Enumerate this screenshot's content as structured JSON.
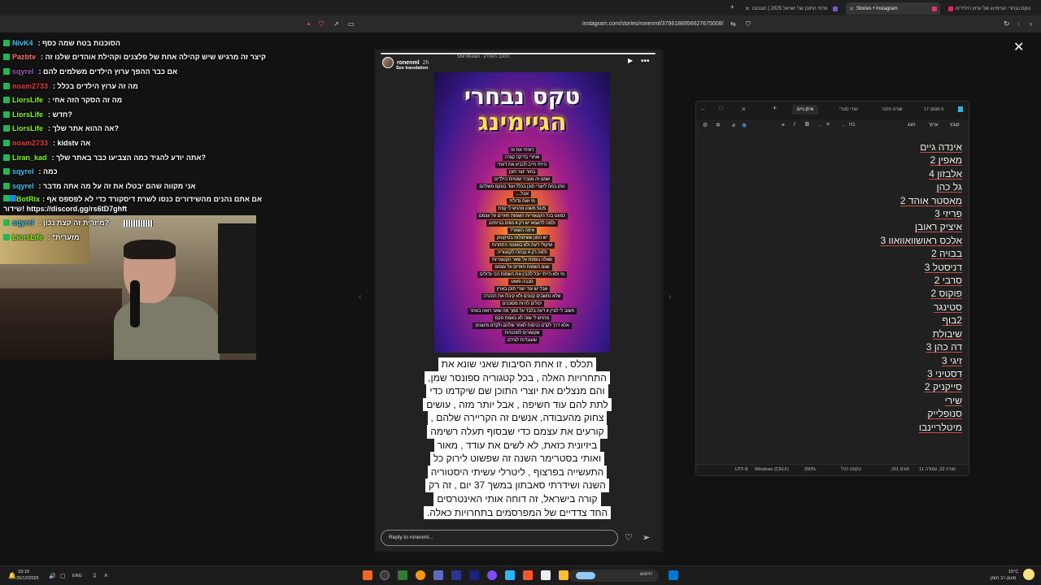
{
  "browser": {
    "tabs": [
      {
        "label": "טקס נבחרי הגיימינג של ערוץ הילידים",
        "color": "#e91e63"
      },
      {
        "label": "Stories • Instagram",
        "color": "#e1306c",
        "active": true
      },
      {
        "label": "פרסי התוכן של ישראל 2025 | הצבעה",
        "color": "#7e57c2"
      }
    ],
    "url": "instagram.com/stories/ronenml/3796188956627675008/"
  },
  "chat": [
    {
      "user": "NivK4",
      "color": "#33c3f0",
      "msg": ": הסוכנות בטח שמה כסף"
    },
    {
      "user": "Pazbtv",
      "color": "#ff6f61",
      "msg": ": קיצר זה מרגיש שיש קהילה אחת של פלצנים וקהילת אוהדים שלנו זה"
    },
    {
      "user": "sqyrel",
      "color": "#9b59b6",
      "msg": ": אם כבר ההפך ערוץ הילדים משלמים להם"
    },
    {
      "user": "noam2733",
      "color": "#e53935",
      "msg": ": מה זה ערוץ הילדים בכלל"
    },
    {
      "user": "LiorsLife",
      "color": "#7cfc00",
      "msg": ": מה זה הסקר הזה אחי"
    },
    {
      "user": "LiorsLife",
      "color": "#7cfc00",
      "msg": ": חדש?"
    },
    {
      "user": "LiorsLife",
      "color": "#7cfc00",
      "msg": ": אה ההוא אתר שלך?"
    },
    {
      "user": "noam2733",
      "color": "#e53935",
      "msg": ": kidstv אה"
    },
    {
      "user": "Liran_kad",
      "color": "#7cfc00",
      "msg": ": אתה יודע להגיד כמה הצביעו כבר באתר שלך?"
    },
    {
      "user": "sqyrel",
      "color": "#33c3f0",
      "msg": ": כמה"
    },
    {
      "user": "sqyrel",
      "color": "#33c3f0",
      "msg": ": אני מקווה שהם יבטלו את זה על מה אתה מדבר"
    },
    {
      "user": "BotRix",
      "color": "#7cfc00",
      "msg": ": אם אתם נהנים מהשידורים כנסו לשרת דיסקורד כדי לא לפספס אף שידור! https://discord.gg/rs6tD7ghft",
      "tall": true,
      "bot": true
    },
    {
      "user": "sqyrel",
      "color": "#33c3f0",
      "msg": ": מיזרית זה קצת נכון?"
    },
    {
      "user": "LiorsLife",
      "color": "#7cfc00",
      "msg": ": *מזערית"
    }
  ],
  "story": {
    "username": "ronenml",
    "time": "2h",
    "see_translation": "See translation",
    "music": "Shir Musari · הכוכב האחרון",
    "poster_title_1": "טקס נבחרי",
    "poster_title_2": "הגיימינג",
    "poster_lines": [
      "ראיתי את זה",
      "ואחרי בדיקה קצרה",
      "הייתי חייב להביע את דעתי",
      "בתור יוצר תוכן",
      "שמנו זה מגביר שטויות הילדים",
      "נותן במה ליוצרי תוכן בכלל ועוד בטקס משלהם",
      "אבל....",
      "מי זאת גדול!!!",
      "SUS משהו מרגיש לי קצת",
      "כמעט בכל הקטגוריות השמות חוזרים על עצמם",
      "ולמה לדוגמא יש רק 4 נשים בגיימינג",
      "איפה השאר?",
      "יש המון ששיפולות בטיקטוק",
      "שיקולי דעת ולא באוונטי התחרות",
      "ולמה רק 4 נבחרו לקטגוריה",
      "שאלה נוספת על שאר הקטגוריות",
      "שגם השמות חוזרים על עצמם",
      "מי ולא הייתי יוכל להבין את השמות הכי גדולים",
      "סבבה פשוט",
      "אבל יש עוד יוצרי תוכן בארץ",
      "שלא נחשבים קטנים ולא קיבלו את ההכרה",
      "יכולים להיות מסוכנים",
      "חשוב לי לציין זו דעה בלבד על סמך מה שאני רואה באתר",
      "מרגיש לי שזה לא באמת טקס",
      "אלא דרך לקדם כניסות לאתר שלהם ולקדם מיוצגים",
      "שקשורים לסוכנויות",
      "שעובדות לצידם"
    ],
    "text_lines": [
      "תכלס , זו אחת הסיבות שאני שונא את",
      "התחרויות האלה , בכל קטגוריה ספונסר שמן,",
      "והם מנצלים את יוצרי התוכן שם שיקדמו כדי",
      "לתת להם עוד חשיפה , אבל יותר מזה , עושים",
      "צחוק מהעבודה, אנשים זה הקריירה שלהם ,",
      "קורעים את עצמם כדי שבסוף תעלה רשימה",
      "ביזיונית כזאת, לא לשים את עודד , מאור",
      "ואותי בסטרימר השנה זה שפשוט לירוק כל",
      "התעשייה בפרצוף , ליטרלי עשיתי היסטוריה",
      "השנה ושידרתי סאבתון במשך 37 יום , זה רק",
      "קורה בישראל, זה דוחה אותי האינטרסים",
      "החד צדדיים של המפרסמים בתחרויות כאלה."
    ],
    "reply_placeholder": "Reply to ronenml..."
  },
  "notepad": {
    "tabs": [
      "איתן גיים",
      "יוצרי סטרי",
      "שורט תחבי",
      "פ פוסט 17"
    ],
    "menu": [
      "קובץ",
      "ערוך",
      "הצג"
    ],
    "format": "H1",
    "lines": [
      "אינדה גיים",
      "מאפין 2",
      "אלבזון 4",
      "גל כהן",
      "מאסטר אוהד 2",
      "פריזי 3",
      "איציק ראובן",
      "אלכס ראושוואוואוו 3",
      "בבויה 2",
      "דניסטל 3",
      "סרבי 2",
      "פוקוס 2",
      "סטינגר",
      "2בוף",
      "שיבולת",
      "דה כהן 3",
      "זיגי 3",
      "דסטיני 3",
      "סייקניק 2",
      "שירי",
      "סנופלייק",
      "מיטלריינבו"
    ],
    "status": {
      "position": "שורה 22, עמודה 11",
      "chars": "201 תווים",
      "format": "טקסט רגיל",
      "zoom": "200%",
      "eol": "Windows (CRLF)",
      "encoding": "UTF-8"
    }
  },
  "taskbar": {
    "time": "19:19",
    "date": "26/12/2025",
    "lang": "ENG",
    "search": "חיפוש",
    "weather": "15°C",
    "weather_desc": "מעונן רב הזמן"
  }
}
